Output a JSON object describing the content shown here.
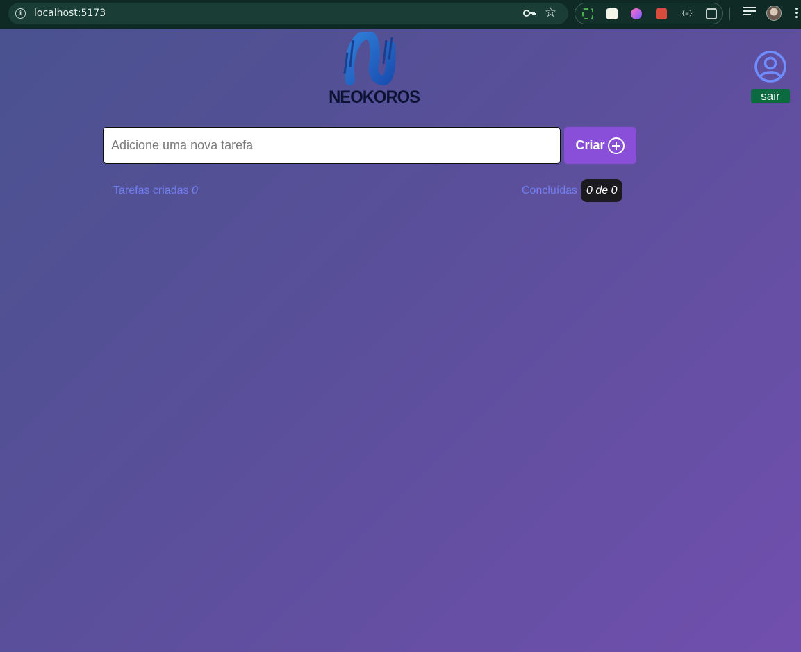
{
  "browser": {
    "url": "localhost:5173",
    "extensions": [
      "screen-capture-icon",
      "sheets-icon",
      "gradient-icon",
      "puzzle-red-icon",
      "json-icon",
      "extensions-icon"
    ],
    "ext5_label": "{≡}"
  },
  "header": {
    "logo_text": "NEOKOROS",
    "logout_label": "sair"
  },
  "task_form": {
    "placeholder": "Adicione uma nova tarefa",
    "value": "",
    "create_label": "Criar"
  },
  "stats": {
    "created_label": "Tarefas criadas",
    "created_count": "0",
    "done_label": "Concluídas",
    "done_badge": "0 de 0"
  },
  "colors": {
    "accent": "#8a4fd8",
    "logout": "#0b6a3f",
    "stat_text": "#6f7ff0",
    "user_icon": "#6f8dff"
  }
}
